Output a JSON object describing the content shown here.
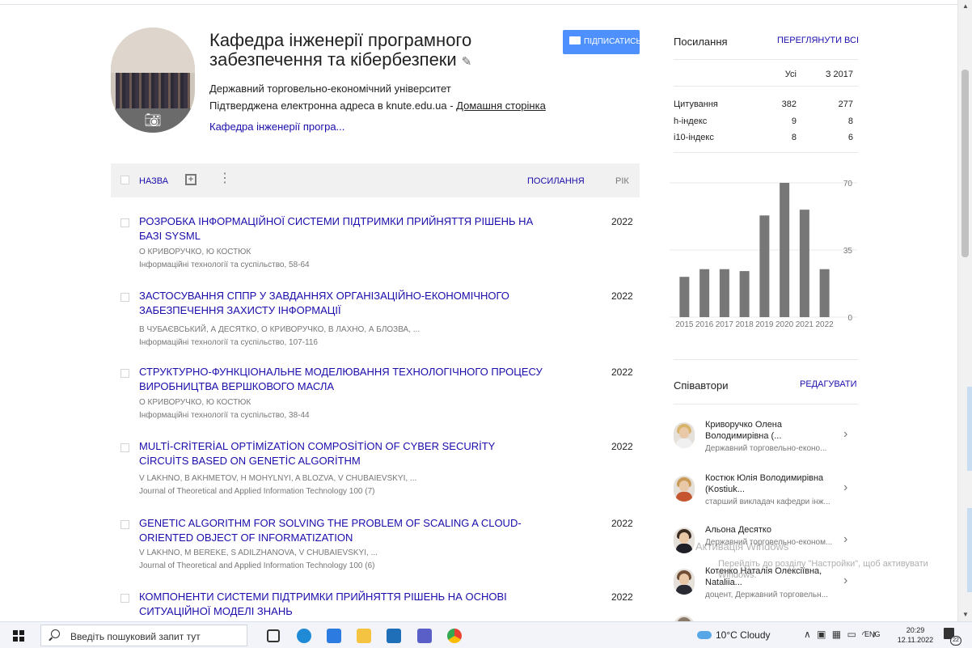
{
  "profile": {
    "name": "Кафедра інженерії програмного забезпечення та кібербезпеки",
    "affiliation": "Державний торговельно-економічний університет",
    "email_verified": "Підтверджена електронна адреса в knute.edu.ua - ",
    "homepage": "Домашня сторінка",
    "interest": "Кафедра інженерії програ..."
  },
  "follow_button": {
    "label": "ПІДПИСАТИСЬ"
  },
  "table_header": {
    "title": "НАЗВА",
    "cited_by": "ПОСИЛАННЯ",
    "year": "РІК"
  },
  "articles": [
    {
      "title": "РОЗРОБКА ІНФОРМАЦІЙНОЇ СИСТЕМИ ПІДТРИМКИ ПРИЙНЯТТЯ РІШЕНЬ НА БАЗІ SYSML",
      "authors": "О КРИВОРУЧКО, Ю КОСТЮК",
      "venue": "Інформаційні технології та суспільство, 58-64",
      "year": "2022"
    },
    {
      "title": "ЗАСТОСУВАННЯ СППР У ЗАВДАННЯХ ОРГАНІЗАЦІЙНО-ЕКОНОМІЧНОГО ЗАБЕЗПЕЧЕННЯ ЗАХИСТУ ІНФОРМАЦІЇ",
      "authors": "В ЧУБАЄВСЬКИЙ, А ДЕСЯТКО, О КРИВОРУЧКО, В ЛАХНО, А БЛОЗВА, ...",
      "venue": "Інформаційні технології та суспільство, 107-116",
      "year": "2022"
    },
    {
      "title": "СТРУКТУРНО-ФУНКЦІОНАЛЬНЕ МОДЕЛЮВАННЯ ТЕХНОЛОГІЧНОГО ПРОЦЕСУ ВИРОБНИЦТВА ВЕРШКОВОГО МАСЛА",
      "authors": "О КРИВОРУЧКО, Ю КОСТЮК",
      "venue": "Інформаційні технології та суспільство, 38-44",
      "year": "2022"
    },
    {
      "title": "MULTİ-CRİTERİAL OPTİMİZATİON COMPOSİTİON OF CYBER SECURİTY CİRCUİTS BASED ON GENETİC ALGORİTHM",
      "authors": "V LAKHNO, B AKHMETOV, H MOHYLNYI, A BLOZVA, V CHUBAIEVSKYI, ...",
      "venue": "Journal of Theoretical and Applied Information Technology 100 (7)",
      "year": "2022"
    },
    {
      "title": "GENETIC ALGORITHM FOR SOLVING THE PROBLEM OF SCALING A CLOUD-ORIENTED OBJECT OF INFORMATIZATION",
      "authors": "V LAKHNO, M BEREKE, S ADILZHANOVA, V CHUBAIEVSKYI, ...",
      "venue": "Journal of Theoretical and Applied Information Technology 100 (6)",
      "year": "2022"
    },
    {
      "title": "КОМПОНЕНТИ СИСТЕМИ ПІДТРИМКИ ПРИЙНЯТТЯ РІШЕНЬ НА ОСНОВІ СИТУАЦІЙНОЇ МОДЕЛІ ЗНАНЬ",
      "authors": "",
      "venue": "",
      "year": "2022"
    }
  ],
  "citations_panel": {
    "title": "Посилання",
    "view_all": "ПЕРЕГЛЯНУТИ ВСІ",
    "col_all": "Усі",
    "col_since": "З 2017",
    "rows": [
      {
        "label": "Цитування",
        "all": "382",
        "since": "277"
      },
      {
        "label": "h-індекс",
        "all": "9",
        "since": "8"
      },
      {
        "label": "i10-індекс",
        "all": "8",
        "since": "6"
      }
    ]
  },
  "chart_data": {
    "type": "bar",
    "categories": [
      "2015",
      "2016",
      "2017",
      "2018",
      "2019",
      "2020",
      "2021",
      "2022"
    ],
    "values": [
      21,
      25,
      25,
      24,
      53,
      70,
      56,
      25
    ],
    "ylim": [
      0,
      70
    ],
    "yticks": [
      "0",
      "35",
      "70"
    ],
    "color": "#777777",
    "grid": true
  },
  "coauthors_panel": {
    "title": "Співавтори",
    "edit": "РЕДАГУВАТИ",
    "items": [
      {
        "name": "Криворучко Олена Володимирівна (...",
        "affiliation": "Державний торговельно-еконо..."
      },
      {
        "name": "Костюк Юлія Володимирівна (Kostiuk...",
        "affiliation": "старший викладач кафедри інж..."
      },
      {
        "name": "Альона Десятко",
        "affiliation": "Державний торговельно-економ..."
      },
      {
        "name": "Котенко Наталія Олексіївна, Nataliia...",
        "affiliation": "доцент, Державний торговельн..."
      }
    ]
  },
  "windows_activation": {
    "title": "Активація Windows",
    "message": "Перейдіть до розділу \"Настройки\", щоб активувати Windows."
  },
  "taskbar": {
    "search_placeholder": "Введіть пошуковий запит тут",
    "weather": "10°C  Cloudy",
    "language": "ENG",
    "time": "20:29",
    "date": "12.11.2022",
    "notification_count": "22"
  },
  "colors": {
    "link": "#1a0dab",
    "button": "#4d90fe",
    "bar": "#777777"
  }
}
